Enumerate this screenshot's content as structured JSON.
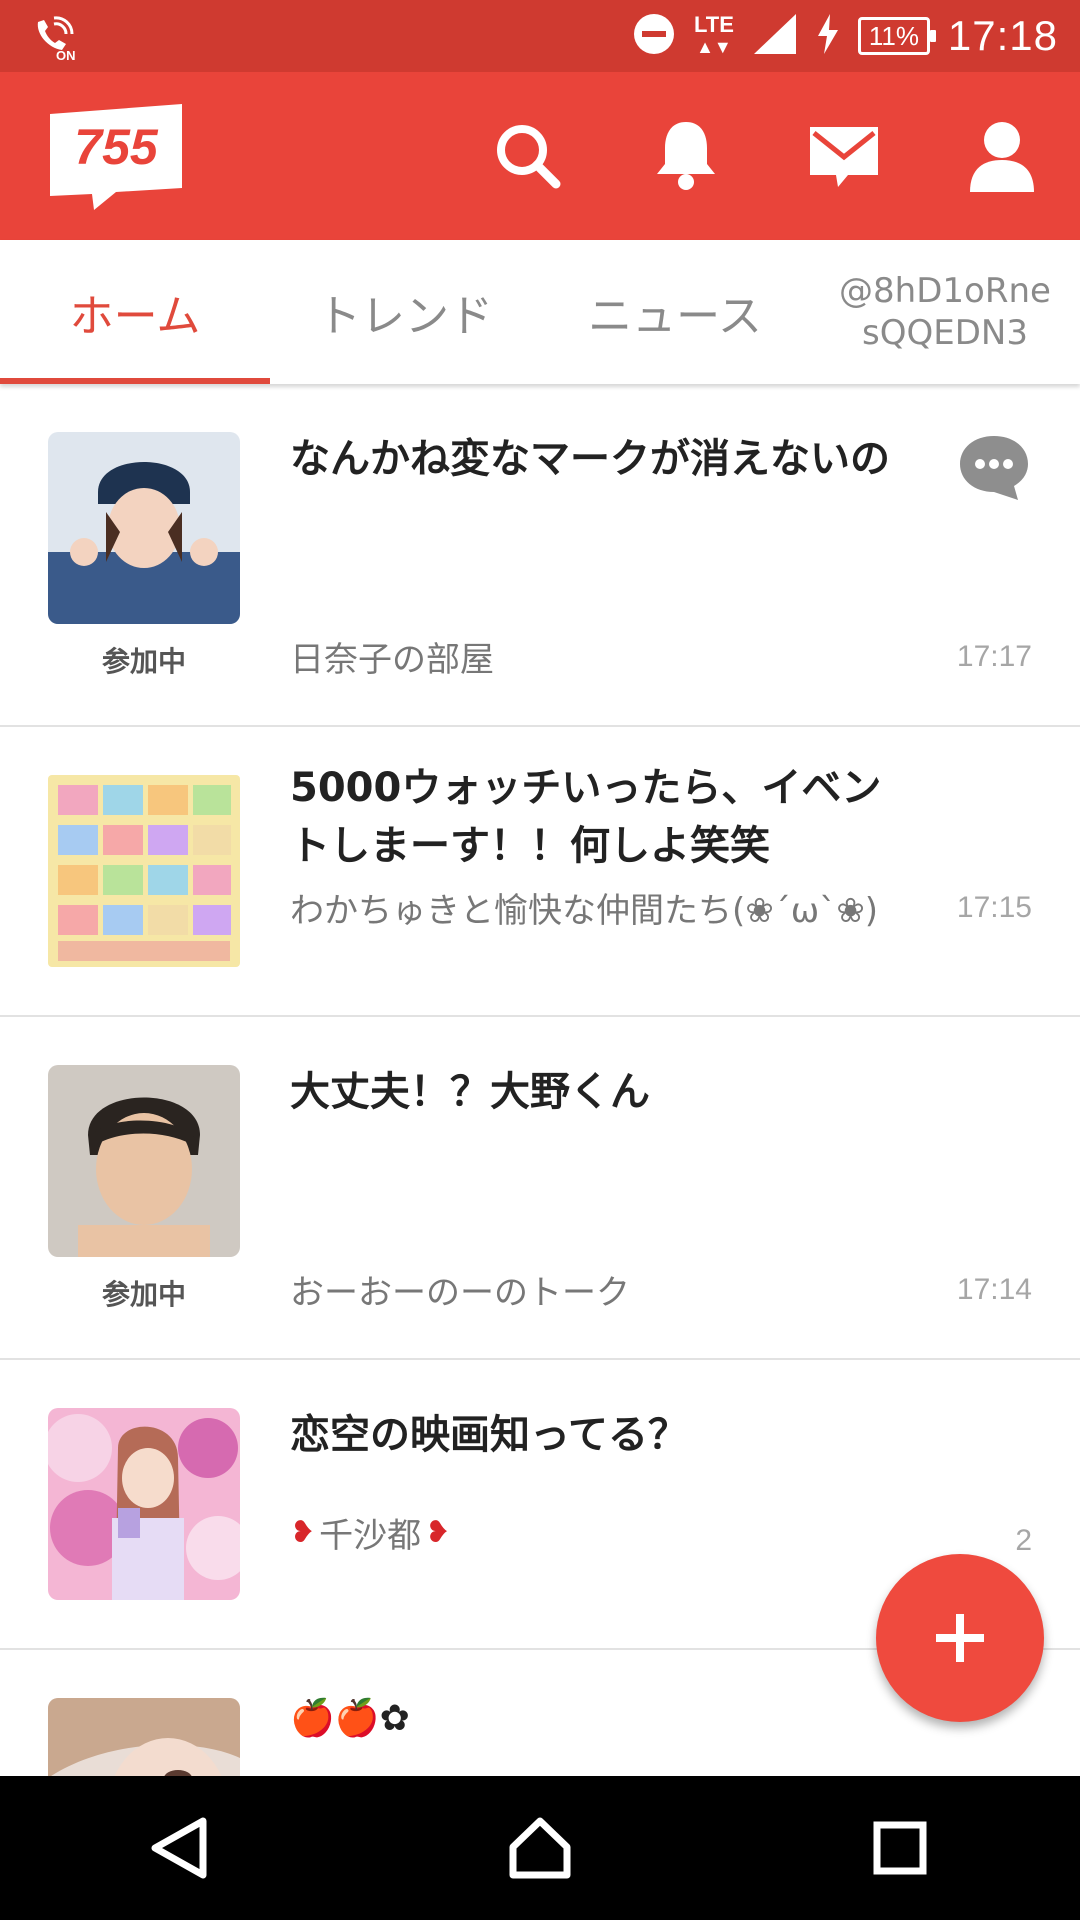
{
  "status_bar": {
    "left_icon": "volte-call-icon",
    "network": "LTE",
    "battery": "11%",
    "time": "17:18"
  },
  "app_bar": {
    "logo_text": "755",
    "actions": [
      "search-icon",
      "bell-icon",
      "mail-icon",
      "profile-icon"
    ]
  },
  "tabs": [
    {
      "label": "ホーム",
      "active": true
    },
    {
      "label": "トレンド"
    },
    {
      "label": "ニュース"
    },
    {
      "label": "@8hD1oRne\nsQQEDN3"
    }
  ],
  "feed": [
    {
      "title": "なんかね変なマークが消えないの",
      "room": "日奈子の部屋",
      "time": "17:17",
      "joined": "参加中",
      "has_comment_badge": true
    },
    {
      "title": "5000ウォッチいったら、イベントしまーす！！何しよ笑笑",
      "room": "わかちゅきと愉快な仲間たち(❀´ω`❀)",
      "time": "17:15"
    },
    {
      "title": "大丈夫！？大野くん",
      "room": "おーおーのーのトーク",
      "time": "17:14",
      "joined": "参加中"
    },
    {
      "title": "恋空の映画知ってる？",
      "room": "千沙都",
      "time": "2"
    },
    {
      "title": "🍎🍎✿",
      "room": "",
      "time": ""
    }
  ],
  "colors": {
    "status_bar": "#cf3a30",
    "app_bar": "#e9443a",
    "accent": "#e04a3c",
    "fab": "#ef4a3e"
  },
  "fab": {
    "icon": "plus-icon"
  },
  "nav": [
    "back-icon",
    "home-icon",
    "recents-icon"
  ]
}
